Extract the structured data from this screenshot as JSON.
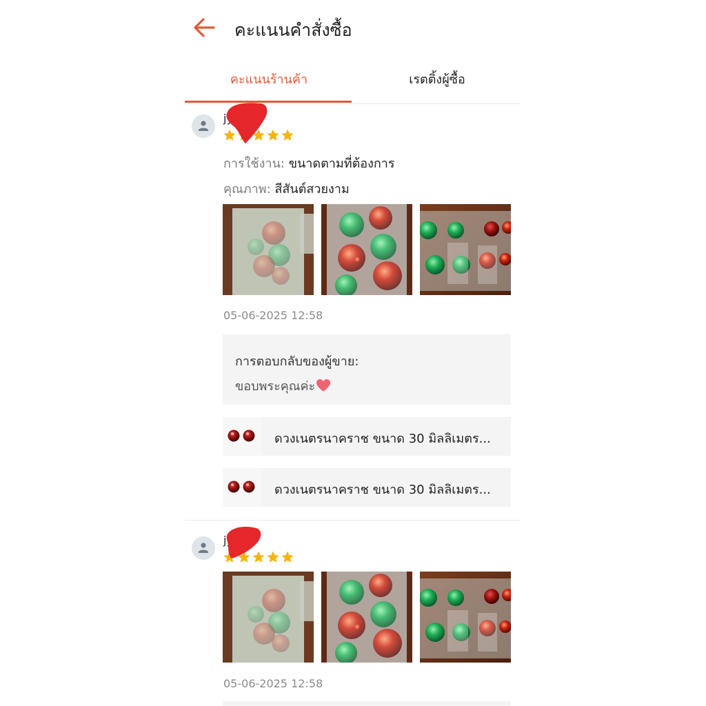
{
  "header": {
    "back_icon": "arrow-left-icon",
    "title": "คะแนนคำสั่งซื้อ"
  },
  "tabs": [
    {
      "label": "คะแนนร้านค้า",
      "active": true
    },
    {
      "label": "เรตติ้งผู้ซื้อ",
      "active": false
    }
  ],
  "colors": {
    "accent": "#e05a36",
    "star": "#f6b40e",
    "redaction": "#e3272b"
  },
  "reviews": [
    {
      "username": "jy 07",
      "rating": 5,
      "attributes": [
        {
          "label": "การใช้งาน:",
          "value": "ขนาดตามที่ต้องการ"
        },
        {
          "label": "คุณภาพ:",
          "value": "สีสันต์สวยงาม"
        }
      ],
      "photo_count": 3,
      "timestamp": "05-06-2025 12:58",
      "seller_reply": {
        "label": "การตอบกลับของผู้ขาย:",
        "text": "ขอบพระคุณค่ะ"
      },
      "products": [
        {
          "name": "ดวงเนตรนาคราช ขนาด 30 มิลลิเมตร..."
        },
        {
          "name": "ดวงเนตรนาคราช ขนาด 30 มิลลิเมตร..."
        }
      ]
    },
    {
      "username": "jy 07",
      "rating": 5,
      "photo_count": 3,
      "timestamp": "05-06-2025 12:58"
    }
  ]
}
